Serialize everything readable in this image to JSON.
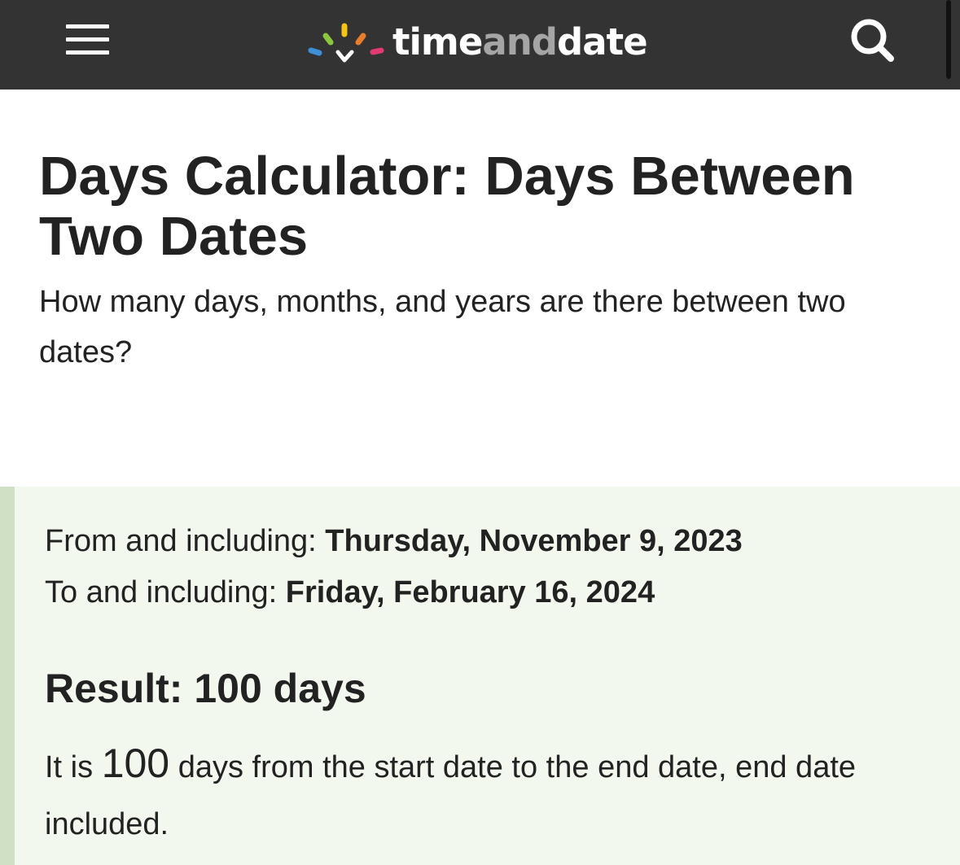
{
  "header": {
    "logo": {
      "part_time": "time",
      "part_and": "and",
      "part_date": "date"
    },
    "icons": {
      "menu": "hamburger-menu-icon",
      "search": "search-icon",
      "logo_mark": "timeanddate-logo-icon"
    },
    "colors": {
      "bar_background": "#333333",
      "logo_accent_blue": "#3f8fd6",
      "logo_accent_green": "#8cc63f",
      "logo_accent_yellow": "#f6c415",
      "logo_accent_orange": "#e87d2a",
      "logo_accent_pink": "#e23b6f"
    }
  },
  "page": {
    "title": "Days Calculator: Days Between Two Dates",
    "subtitle": "How many days, months, and years are there between two dates?"
  },
  "result": {
    "from_label": "From and including:",
    "from_value": "Thursday, November 9, 2023",
    "to_label": "To and including:",
    "to_value": "Friday, February 16, 2024",
    "heading": "Result: 100 days",
    "desc_prefix": "It is",
    "desc_number": "100",
    "desc_suffix": "days from the start date to the end date, end date included.",
    "colors": {
      "panel_background": "#f3f8ee",
      "accent_bar": "#cfe0c4"
    }
  }
}
